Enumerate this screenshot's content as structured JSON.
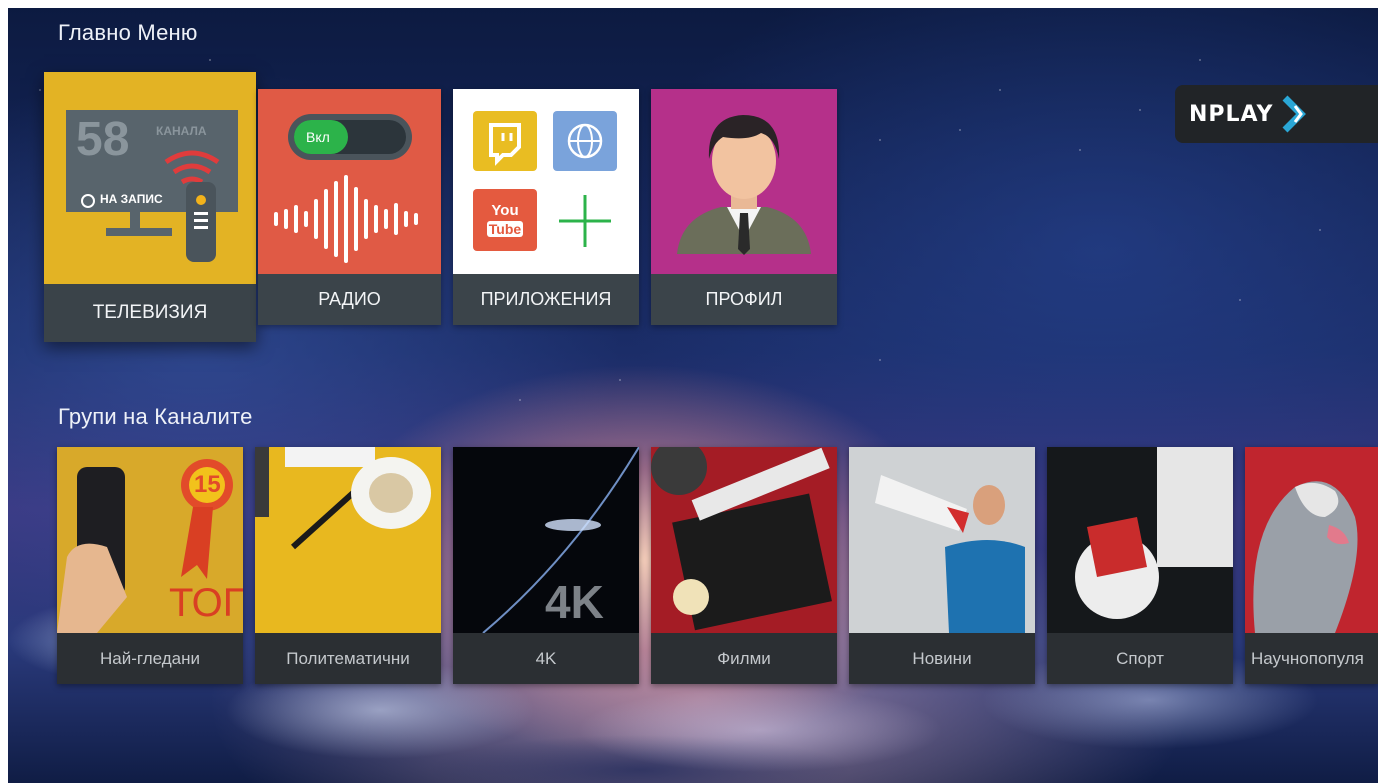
{
  "header": {
    "main_menu_title": "Главно Меню",
    "logo_text": "NPLAY"
  },
  "main_tiles": [
    {
      "label": "ТЕЛЕВИЗИЯ",
      "art": {
        "channel_count": "58",
        "channel_word": "КАНАЛА",
        "record_text": "НА ЗАПИС"
      },
      "color": "#e3b324",
      "focused": true
    },
    {
      "label": "РАДИО",
      "art": {
        "toggle_text": "Вкл"
      },
      "color": "#e05a45"
    },
    {
      "label": "ПРИЛОЖЕНИЯ",
      "art": {
        "icons": [
          "twitch-icon",
          "web-icon",
          "youtube-icon",
          "add-icon"
        ],
        "youtube_text_top": "You",
        "youtube_text_bottom": "Tube"
      },
      "color": "#ffffff"
    },
    {
      "label": "ПРОФИЛ",
      "art": {
        "icon": "user-avatar-icon"
      },
      "color": "#b5308a"
    }
  ],
  "groups_section": {
    "title": "Групи на Каналите",
    "items": [
      {
        "label": "Най-гледани",
        "art_text": "ТОП",
        "badge": "15"
      },
      {
        "label": "Политематични"
      },
      {
        "label": "4K",
        "art_text": "4K"
      },
      {
        "label": "Филми"
      },
      {
        "label": "Новини"
      },
      {
        "label": "Спорт"
      },
      {
        "label": "Научнопопуля"
      }
    ]
  },
  "colors": {
    "accent_green": "#2cb34a",
    "tile_label_bg": "#3b444a",
    "logo_bg": "#212427",
    "logo_chevron": "#2aa7d6"
  }
}
